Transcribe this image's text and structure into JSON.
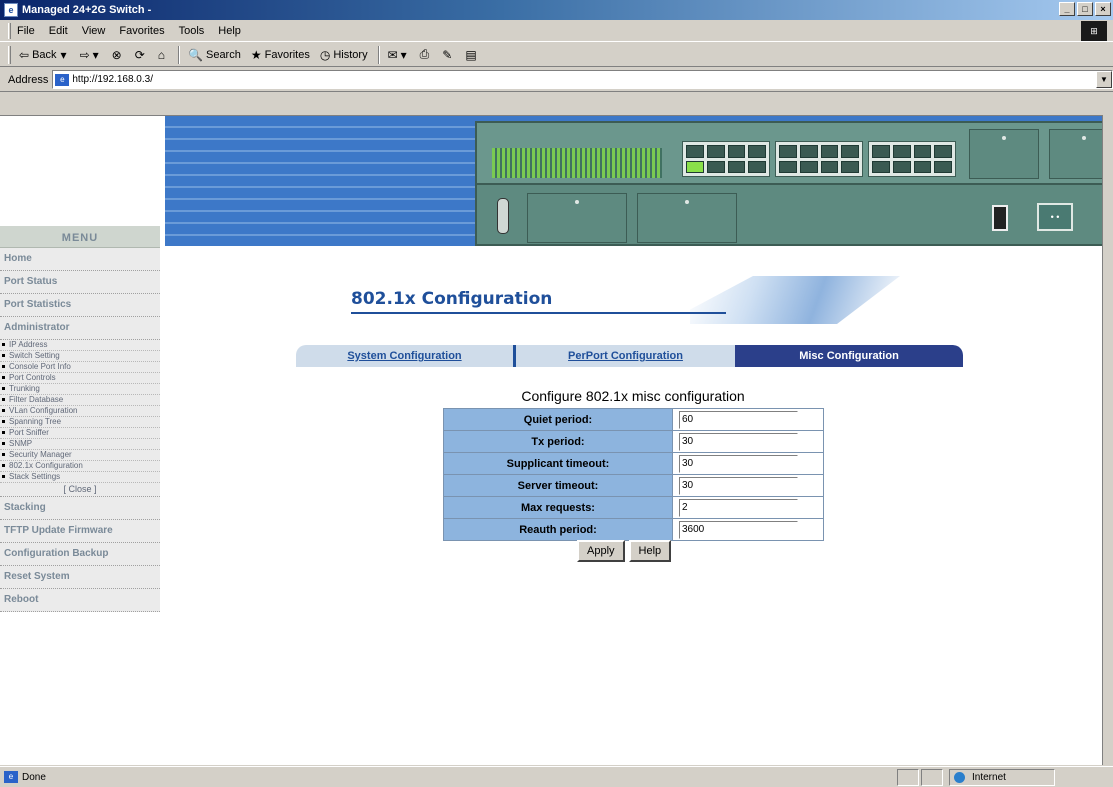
{
  "window": {
    "title": "Managed 24+2G Switch -",
    "icon": "ie-page-icon"
  },
  "menubar": [
    "File",
    "Edit",
    "View",
    "Favorites",
    "Tools",
    "Help"
  ],
  "toolbar": {
    "back": "Back",
    "search": "Search",
    "favorites": "Favorites",
    "history": "History"
  },
  "address": {
    "label": "Address",
    "url": "http://192.168.0.3/"
  },
  "menu": {
    "header": "MENU",
    "items_top": [
      "Home",
      "Port Status",
      "Port Statistics",
      "Administrator"
    ],
    "sub_items": [
      "IP Address",
      "Switch Setting",
      "Console Port Info",
      "Port Controls",
      "Trunking",
      "Filter Database",
      "VLan Configuration",
      "Spanning Tree",
      "Port Sniffer",
      "SNMP",
      "Security Manager",
      "802.1x Configuration",
      "Stack Settings"
    ],
    "close": "[ Close ]",
    "items_bottom": [
      "Stacking",
      "TFTP Update Firmware",
      "Configuration Backup",
      "Reset System",
      "Reboot"
    ]
  },
  "page": {
    "heading": "802.1x Configuration",
    "tabs": [
      "System Configuration",
      "PerPort Configuration",
      "Misc Configuration"
    ],
    "active_tab": "Misc Configuration",
    "form_title": "Configure 802.1x misc configuration",
    "fields": [
      {
        "label": "Quiet period:",
        "value": "60"
      },
      {
        "label": "Tx period:",
        "value": "30"
      },
      {
        "label": "Supplicant timeout:",
        "value": "30"
      },
      {
        "label": "Server timeout:",
        "value": "30"
      },
      {
        "label": "Max requests:",
        "value": "2"
      },
      {
        "label": "Reauth period:",
        "value": "3600"
      }
    ],
    "apply": "Apply",
    "help": "Help"
  },
  "status": {
    "text": "Done",
    "zone": "Internet"
  },
  "colors": {
    "accent": "#1f4f9a",
    "active_tab": "#2b3f8a",
    "label_cell": "#8db4de",
    "banner": "#3d78c8"
  }
}
